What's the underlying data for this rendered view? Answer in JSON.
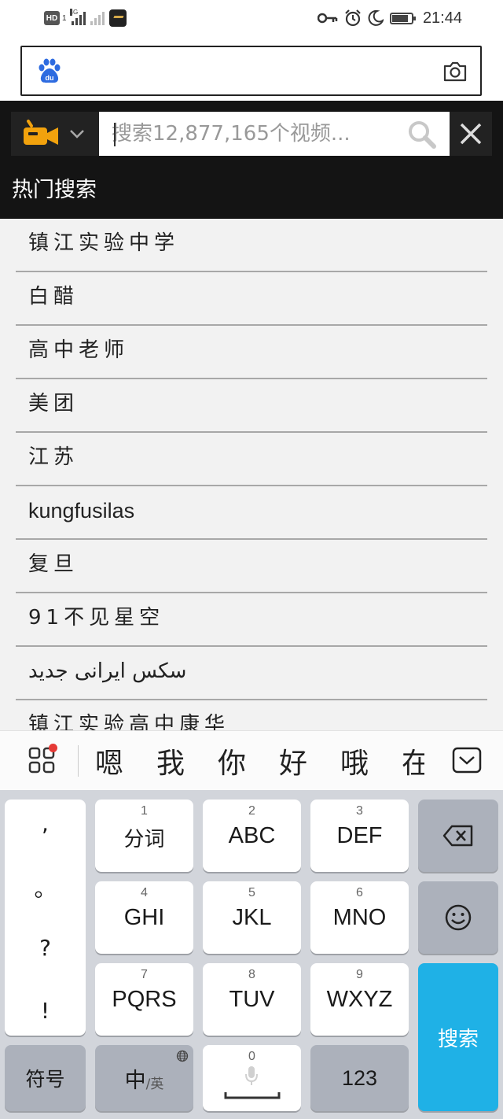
{
  "status_bar": {
    "hd_badge": "HD",
    "sim_number": "1",
    "network": "4G",
    "time": "21:44"
  },
  "browser": {
    "logo_text": "du"
  },
  "video_search": {
    "placeholder": "搜索12,877,165个视频..."
  },
  "hot_searches": {
    "title": "热门搜索",
    "items": [
      "镇江实验中学",
      "白醋",
      "高中老师",
      "美团",
      "江苏",
      "kungfusilas",
      "复旦",
      "91不见星空",
      "سکس ایرانی جدید",
      "镇江实验高中康华"
    ]
  },
  "ime": {
    "candidates": [
      "嗯",
      "我",
      "你",
      "好",
      "哦",
      "在"
    ]
  },
  "keyboard": {
    "punctuation": [
      ",",
      "。",
      "?",
      "!"
    ],
    "keys": [
      {
        "num": "1",
        "label": "分词"
      },
      {
        "num": "2",
        "label": "ABC"
      },
      {
        "num": "3",
        "label": "DEF"
      },
      {
        "num": "4",
        "label": "GHI"
      },
      {
        "num": "5",
        "label": "JKL"
      },
      {
        "num": "6",
        "label": "MNO"
      },
      {
        "num": "7",
        "label": "PQRS"
      },
      {
        "num": "8",
        "label": "TUV"
      },
      {
        "num": "9",
        "label": "WXYZ"
      }
    ],
    "search_label": "搜索",
    "symbols_label": "符号",
    "lang_main": "中",
    "lang_alt": "/英",
    "space_num": "0",
    "numeric_label": "123"
  }
}
